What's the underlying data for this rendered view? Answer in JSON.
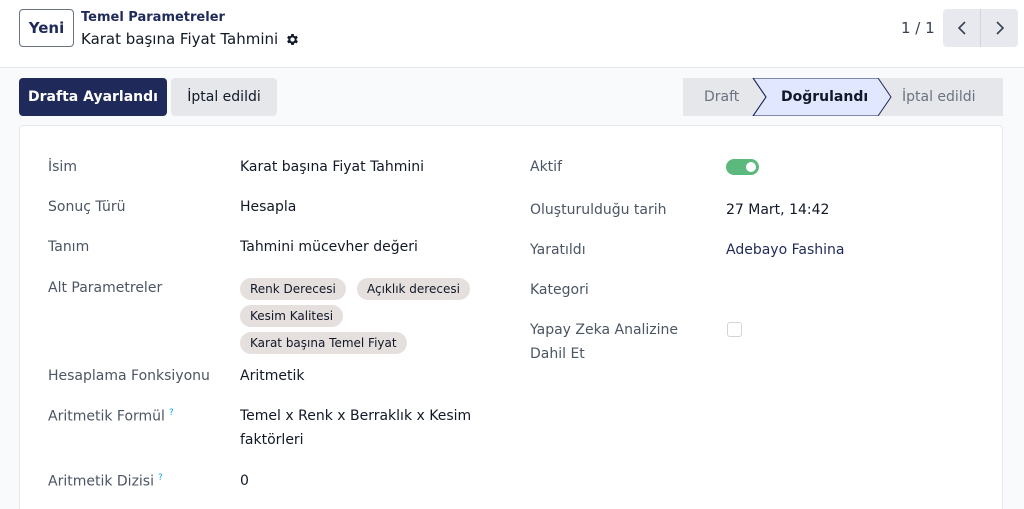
{
  "topbar": {
    "new_label": "Yeni",
    "breadcrumb_parent": "Temel Parametreler",
    "breadcrumb_current": "Karat başına Fiyat Tahmini",
    "pager_text": "1 / 1"
  },
  "actions": {
    "primary_label": "Drafta Ayarlandı",
    "secondary_label": "İptal edildi"
  },
  "statusbar": {
    "stages": [
      "Draft",
      "Doğrulandı",
      "İptal edildi"
    ],
    "active_index": 1
  },
  "form": {
    "left": [
      {
        "label": "İsim",
        "value": "Karat başına Fiyat Tahmini"
      },
      {
        "label": "Sonuç Türü",
        "value": "Hesapla"
      },
      {
        "label": "Tanım",
        "value": "Tahmini mücevher değeri"
      },
      {
        "label": "Alt Parametreler",
        "tags": [
          "Renk Derecesi",
          "Açıklık derecesi",
          "Kesim Kalitesi",
          "Karat başına Temel Fiyat"
        ]
      },
      {
        "label": "Hesaplama Fonksiyonu",
        "value": "Aritmetik"
      },
      {
        "label": "Aritmetik Formül",
        "help": "?",
        "value_line1": "Temel x Renk x Berraklık x Kesim",
        "value_line2": "faktörleri"
      },
      {
        "label": "Aritmetik Dizisi",
        "help": "?",
        "value": "0"
      }
    ],
    "right": [
      {
        "label": "Aktif",
        "toggle_on": true
      },
      {
        "label": "Oluşturulduğu tarih",
        "value": "27 Mart, 14:42"
      },
      {
        "label": "Yaratıldı",
        "value": "Adebayo Fashina"
      },
      {
        "label": "Kategori",
        "value": ""
      },
      {
        "label_line1": "Yapay Zeka Analizine",
        "label_line2": "Dahil Et",
        "checked": false
      }
    ]
  },
  "colors": {
    "brand": "#1f2a5a",
    "toggle_on": "#5cb97d",
    "tag_bg": "#e5dfde",
    "help": "#0ea5e9"
  }
}
